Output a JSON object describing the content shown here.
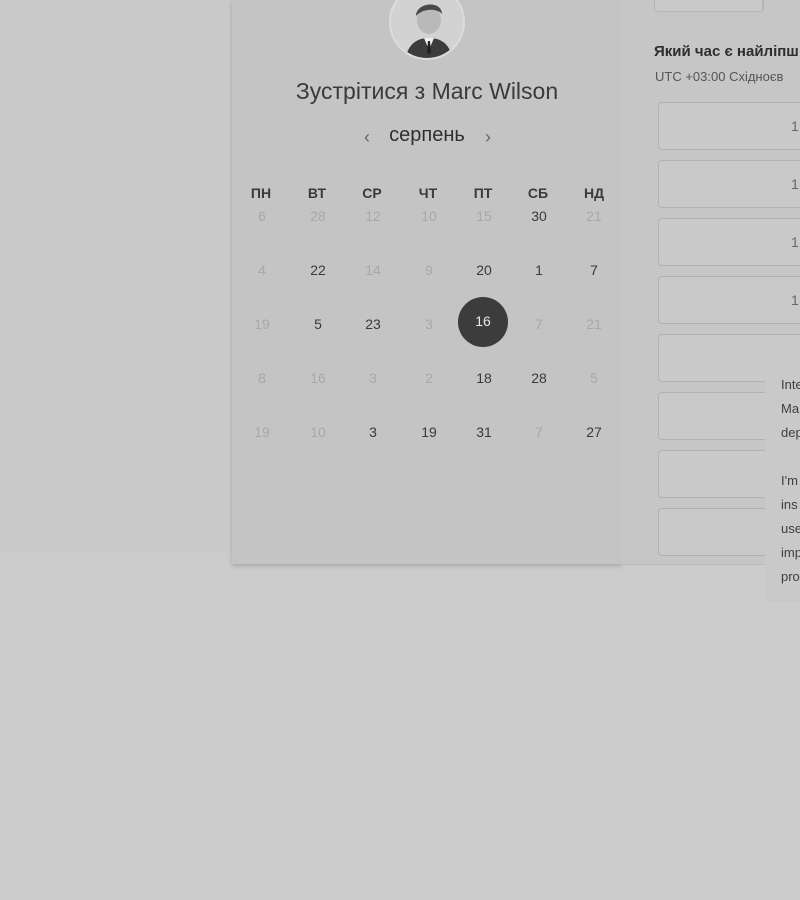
{
  "header": {
    "title": "Зустрітися з Marc Wilson"
  },
  "calendar": {
    "month": "серпень",
    "weekdays": [
      "ПН",
      "ВТ",
      "СР",
      "ЧТ",
      "ПТ",
      "СБ",
      "НД"
    ],
    "weeks": [
      [
        "6",
        "28",
        "12",
        "10",
        "15",
        "30",
        "21"
      ],
      [
        "4",
        "22",
        "14",
        "9",
        "20",
        "1",
        "7"
      ],
      [
        "19",
        "5",
        "23",
        "3",
        "16",
        "7",
        "21"
      ],
      [
        "8",
        "16",
        "3",
        "2",
        "18",
        "28",
        "5"
      ],
      [
        "19",
        "10",
        "3",
        "19",
        "31",
        "7",
        "27"
      ]
    ],
    "selected_day": "16"
  },
  "schedule": {
    "question": "Який час є найліпш",
    "timezone": "UTC +03:00 Східноєв",
    "slots": [
      "1",
      "1",
      "1",
      "1"
    ]
  },
  "popover": {
    "lines": [
      "Inte",
      "Ma",
      "dep",
      "",
      "I'm",
      "ins",
      "use",
      "imp",
      "pro"
    ]
  }
}
